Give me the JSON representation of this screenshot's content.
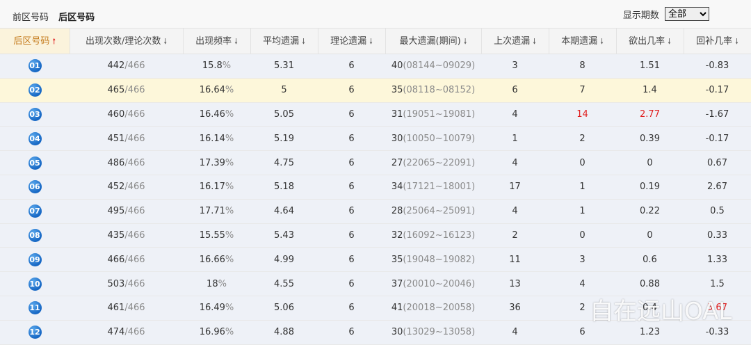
{
  "tabs": [
    {
      "label": "前区号码",
      "active": false
    },
    {
      "label": "后区号码",
      "active": true
    }
  ],
  "period": {
    "label": "显示期数",
    "selected": "全部"
  },
  "columns": [
    {
      "label": "后区号码",
      "sort": "up"
    },
    {
      "label": "出现次数/理论次数",
      "sort": "down"
    },
    {
      "label": "出现频率",
      "sort": "down"
    },
    {
      "label": "平均遗漏",
      "sort": "down"
    },
    {
      "label": "理论遗漏",
      "sort": "down"
    },
    {
      "label": "最大遗漏(期间)",
      "sort": "down"
    },
    {
      "label": "上次遗漏",
      "sort": "down"
    },
    {
      "label": "本期遗漏",
      "sort": "down"
    },
    {
      "label": "欲出几率",
      "sort": "down"
    },
    {
      "label": "回补几率",
      "sort": "down"
    }
  ],
  "rows": [
    {
      "num": "01",
      "count": "442",
      "theory": "/466",
      "freq": "15.8",
      "pct": "%",
      "avg": "5.31",
      "teo": "6",
      "max": "40",
      "maxrange": "(08144~09029)",
      "last": "3",
      "cur": "8",
      "cur_red": false,
      "want": "1.51",
      "want_red": false,
      "back": "-0.83",
      "back_red": false
    },
    {
      "num": "02",
      "count": "465",
      "theory": "/466",
      "freq": "16.64",
      "pct": "%",
      "avg": "5",
      "teo": "6",
      "max": "35",
      "maxrange": "(08118~08152)",
      "last": "6",
      "cur": "7",
      "cur_red": false,
      "want": "1.4",
      "want_red": false,
      "back": "-0.17",
      "back_red": false
    },
    {
      "num": "03",
      "count": "460",
      "theory": "/466",
      "freq": "16.46",
      "pct": "%",
      "avg": "5.05",
      "teo": "6",
      "max": "31",
      "maxrange": "(19051~19081)",
      "last": "4",
      "cur": "14",
      "cur_red": true,
      "want": "2.77",
      "want_red": true,
      "back": "-1.67",
      "back_red": false
    },
    {
      "num": "04",
      "count": "451",
      "theory": "/466",
      "freq": "16.14",
      "pct": "%",
      "avg": "5.19",
      "teo": "6",
      "max": "30",
      "maxrange": "(10050~10079)",
      "last": "1",
      "cur": "2",
      "cur_red": false,
      "want": "0.39",
      "want_red": false,
      "back": "-0.17",
      "back_red": false
    },
    {
      "num": "05",
      "count": "486",
      "theory": "/466",
      "freq": "17.39",
      "pct": "%",
      "avg": "4.75",
      "teo": "6",
      "max": "27",
      "maxrange": "(22065~22091)",
      "last": "4",
      "cur": "0",
      "cur_red": false,
      "want": "0",
      "want_red": false,
      "back": "0.67",
      "back_red": false
    },
    {
      "num": "06",
      "count": "452",
      "theory": "/466",
      "freq": "16.17",
      "pct": "%",
      "avg": "5.18",
      "teo": "6",
      "max": "34",
      "maxrange": "(17121~18001)",
      "last": "17",
      "cur": "1",
      "cur_red": false,
      "want": "0.19",
      "want_red": false,
      "back": "2.67",
      "back_red": false
    },
    {
      "num": "07",
      "count": "495",
      "theory": "/466",
      "freq": "17.71",
      "pct": "%",
      "avg": "4.64",
      "teo": "6",
      "max": "28",
      "maxrange": "(25064~25091)",
      "last": "4",
      "cur": "1",
      "cur_red": false,
      "want": "0.22",
      "want_red": false,
      "back": "0.5",
      "back_red": false
    },
    {
      "num": "08",
      "count": "435",
      "theory": "/466",
      "freq": "15.55",
      "pct": "%",
      "avg": "5.43",
      "teo": "6",
      "max": "32",
      "maxrange": "(16092~16123)",
      "last": "2",
      "cur": "0",
      "cur_red": false,
      "want": "0",
      "want_red": false,
      "back": "0.33",
      "back_red": false
    },
    {
      "num": "09",
      "count": "466",
      "theory": "/466",
      "freq": "16.66",
      "pct": "%",
      "avg": "4.99",
      "teo": "6",
      "max": "35",
      "maxrange": "(19048~19082)",
      "last": "11",
      "cur": "3",
      "cur_red": false,
      "want": "0.6",
      "want_red": false,
      "back": "1.33",
      "back_red": false
    },
    {
      "num": "10",
      "count": "503",
      "theory": "/466",
      "freq": "18",
      "pct": "%",
      "avg": "4.55",
      "teo": "6",
      "max": "37",
      "maxrange": "(20010~20046)",
      "last": "13",
      "cur": "4",
      "cur_red": false,
      "want": "0.88",
      "want_red": false,
      "back": "1.5",
      "back_red": false
    },
    {
      "num": "11",
      "count": "461",
      "theory": "/466",
      "freq": "16.49",
      "pct": "%",
      "avg": "5.06",
      "teo": "6",
      "max": "41",
      "maxrange": "(20018~20058)",
      "last": "36",
      "cur": "2",
      "cur_red": false,
      "want": "0.4",
      "want_red": false,
      "back": "5.67",
      "back_red": true
    },
    {
      "num": "12",
      "count": "474",
      "theory": "/466",
      "freq": "16.96",
      "pct": "%",
      "avg": "4.88",
      "teo": "6",
      "max": "30",
      "maxrange": "(13029~13058)",
      "last": "4",
      "cur": "6",
      "cur_red": false,
      "want": "1.23",
      "want_red": false,
      "back": "-0.33",
      "back_red": false
    }
  ],
  "watermark": "自在远山OAL",
  "colors": {
    "accent_blue": "#1667c4",
    "highlight_row": "#fdf7da",
    "red": "#e01e1e",
    "sorted_header": "#c47a1a"
  }
}
